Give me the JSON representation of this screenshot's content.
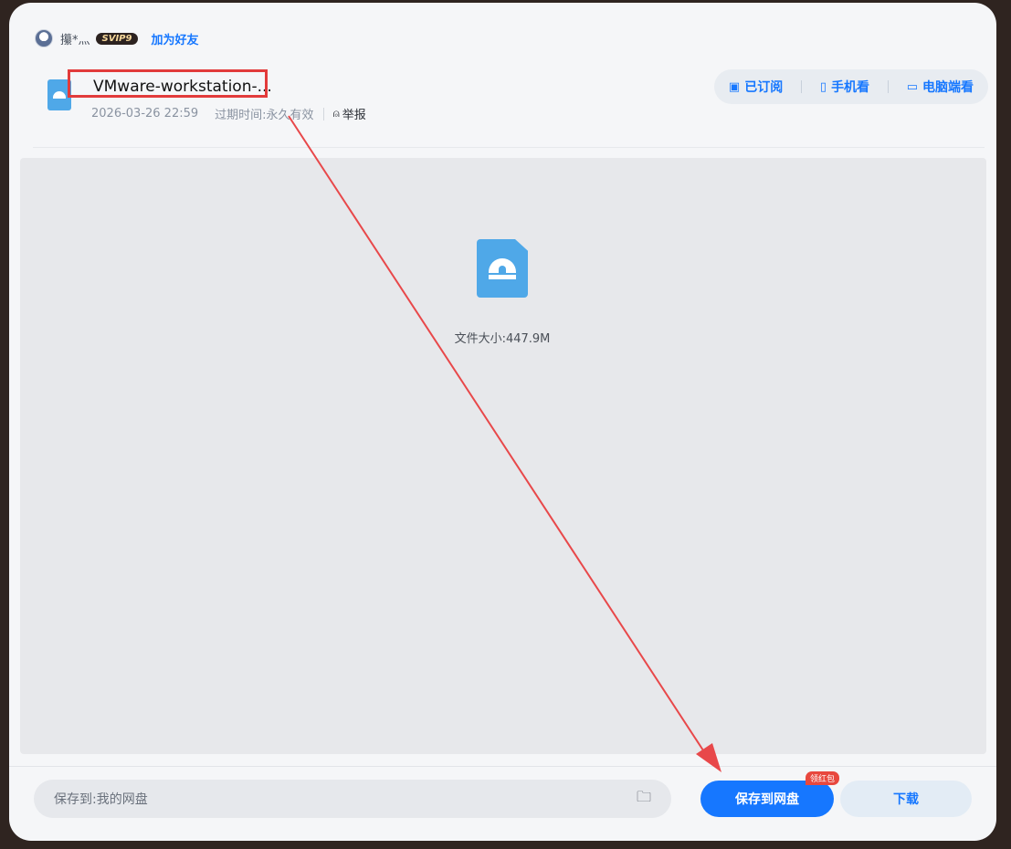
{
  "user": {
    "name": "攥*灬",
    "vip_badge": "SVIP9",
    "add_friend_label": "加为好友"
  },
  "file": {
    "title": "VMware-workstation-...",
    "date": "2026-03-26 22:59",
    "expiry_label": "过期时间:",
    "expiry_value": "永久有效",
    "report_label": "举报",
    "size_text": "文件大小:447.9M"
  },
  "actions": {
    "subscribed_label": "已订阅",
    "phone_view_label": "手机看",
    "pc_view_label": "电脑端看"
  },
  "footer": {
    "save_path": "保存到:我的网盘",
    "save_button_label": "保存到网盘",
    "red_packet_badge": "领红包",
    "download_label": "下载"
  },
  "colors": {
    "accent": "#1677ff",
    "annotation_red": "#e23b3b"
  }
}
